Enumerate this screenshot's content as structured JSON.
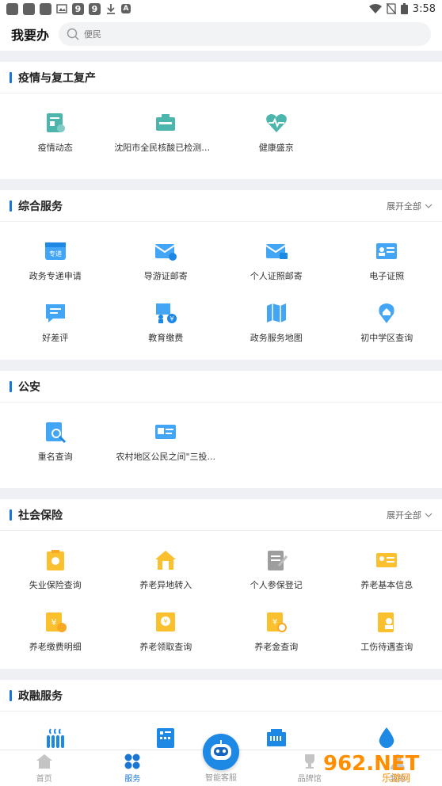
{
  "status_bar": {
    "left_icons": [
      "app-icon",
      "app-icon",
      "app-icon",
      "image-icon",
      "9",
      "9",
      "download-icon",
      "A"
    ],
    "time": "3:58"
  },
  "header": {
    "title": "我要办",
    "search_placeholder": "便民"
  },
  "sections": [
    {
      "title": "疫情与复工复产",
      "expand": "",
      "items": [
        {
          "label": "疫情动态",
          "icon": "epidemic-news-icon",
          "color": "#4db6ac"
        },
        {
          "label": "沈阳市全民核酸已检测证...",
          "icon": "test-certificate-icon",
          "color": "#4db6ac"
        },
        {
          "label": "健康盛京",
          "icon": "health-heart-icon",
          "color": "#4db6ac"
        }
      ]
    },
    {
      "title": "综合服务",
      "expand": "展开全部",
      "items": [
        {
          "label": "政务专递申请",
          "icon": "express-box-icon",
          "color": "#42a5f5"
        },
        {
          "label": "导游证邮寄",
          "icon": "guide-mail-icon",
          "color": "#42a5f5"
        },
        {
          "label": "个人证照邮寄",
          "icon": "personal-mail-icon",
          "color": "#42a5f5"
        },
        {
          "label": "电子证照",
          "icon": "e-license-icon",
          "color": "#42a5f5"
        },
        {
          "label": "好差评",
          "icon": "review-icon",
          "color": "#42a5f5"
        },
        {
          "label": "教育缴费",
          "icon": "education-pay-icon",
          "color": "#42a5f5"
        },
        {
          "label": "政务服务地图",
          "icon": "map-icon",
          "color": "#42a5f5"
        },
        {
          "label": "初中学区查询",
          "icon": "location-pin-icon",
          "color": "#42a5f5"
        }
      ]
    },
    {
      "title": "公安",
      "expand": "",
      "items": [
        {
          "label": "重名查询",
          "icon": "name-search-icon",
          "color": "#42a5f5"
        },
        {
          "label": "农村地区公民之间\"三投...",
          "icon": "id-card-icon",
          "color": "#42a5f5"
        }
      ]
    },
    {
      "title": "社会保险",
      "expand": "展开全部",
      "items": [
        {
          "label": "失业保险查询",
          "icon": "unemployment-icon",
          "color": "#fbc02d"
        },
        {
          "label": "养老异地转入",
          "icon": "pension-transfer-icon",
          "color": "#fbc02d"
        },
        {
          "label": "个人参保登记",
          "icon": "insurance-register-icon",
          "color": "#9e9e9e"
        },
        {
          "label": "养老基本信息",
          "icon": "pension-info-icon",
          "color": "#fbc02d"
        },
        {
          "label": "养老缴费明细",
          "icon": "pension-payment-icon",
          "color": "#fbc02d"
        },
        {
          "label": "养老领取查询",
          "icon": "pension-receive-icon",
          "color": "#fbc02d"
        },
        {
          "label": "养老金查询",
          "icon": "pension-query-icon",
          "color": "#fbc02d"
        },
        {
          "label": "工伤待遇查询",
          "icon": "injury-benefit-icon",
          "color": "#fbc02d"
        }
      ]
    },
    {
      "title": "政融服务",
      "expand": "",
      "items": [
        {
          "label": "",
          "icon": "heating-icon",
          "color": "#1e88e5"
        },
        {
          "label": "",
          "icon": "phone-bill-icon",
          "color": "#1e88e5"
        },
        {
          "label": "",
          "icon": "network-icon",
          "color": "#1e88e5"
        },
        {
          "label": "",
          "icon": "water-drop-icon",
          "color": "#1e88e5"
        }
      ]
    }
  ],
  "bottom_nav": [
    {
      "label": "首页",
      "icon": "home-icon",
      "active": false
    },
    {
      "label": "服务",
      "icon": "grid-icon",
      "active": true
    },
    {
      "label": "智能客服",
      "icon": "robot-icon",
      "active": false
    },
    {
      "label": "品牌馆",
      "icon": "trophy-icon",
      "active": false
    },
    {
      "label": "我的",
      "icon": "user-icon",
      "active": false
    }
  ],
  "watermark": {
    "text": "962.NET",
    "sub": "乐游网"
  }
}
